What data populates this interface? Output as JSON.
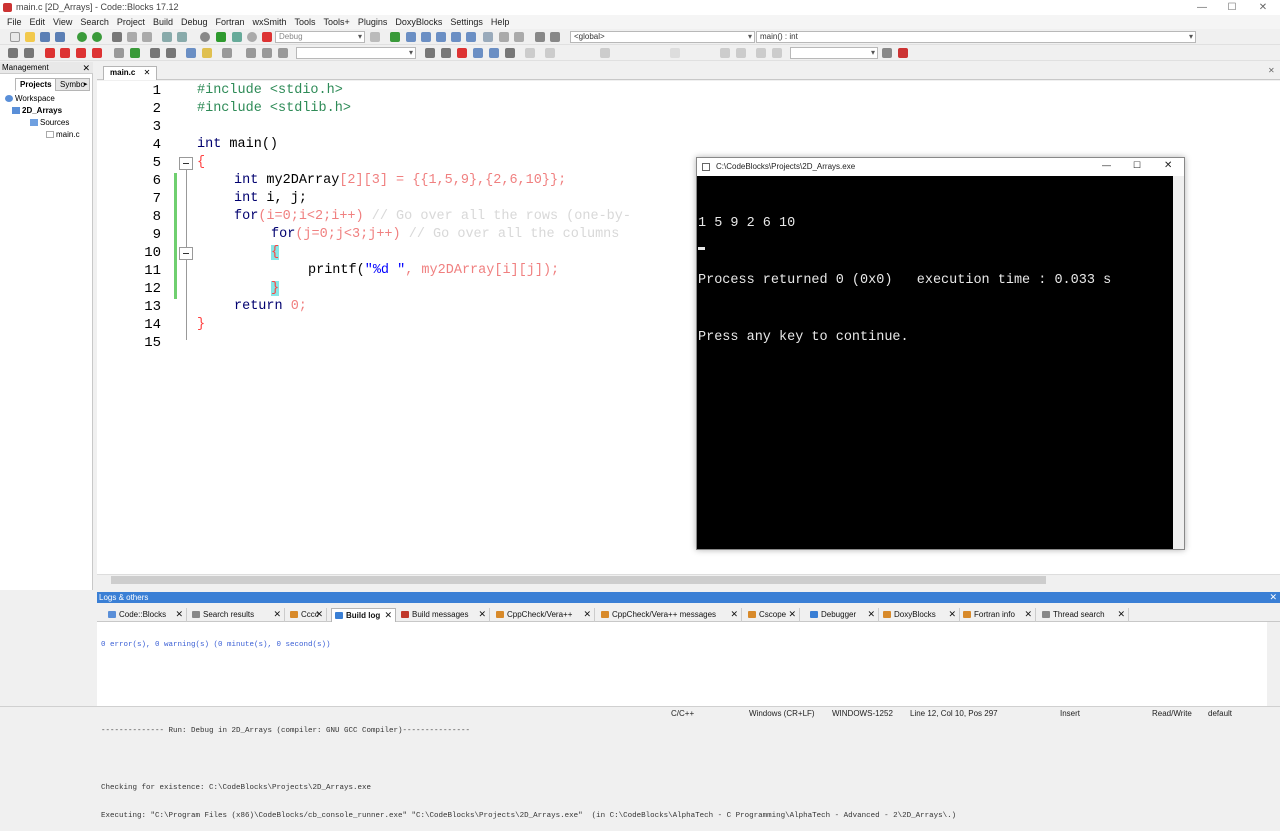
{
  "window": {
    "title": "main.c [2D_Arrays] - Code::Blocks 17.12",
    "min": "—",
    "max": "☐",
    "close": "✕"
  },
  "menu": [
    "File",
    "Edit",
    "View",
    "Search",
    "Project",
    "Build",
    "Debug",
    "Fortran",
    "wxSmith",
    "Tools",
    "Tools+",
    "Plugins",
    "DoxyBlocks",
    "Settings",
    "Help"
  ],
  "toolbar": {
    "build_target": "Debug",
    "scope": "<global>",
    "symbol": "main() : int"
  },
  "management": {
    "header": "Management",
    "close": "✕",
    "tabs": [
      "Projects",
      "Symbo"
    ],
    "tree": {
      "workspace": "Workspace",
      "project": "2D_Arrays",
      "sources": "Sources",
      "file": "main.c"
    }
  },
  "editor": {
    "tab": "main.c",
    "tab_close": "✕",
    "line_numbers": [
      "1",
      "2",
      "3",
      "4",
      "5",
      "6",
      "7",
      "8",
      "9",
      "10",
      "11",
      "12",
      "13",
      "14",
      "15"
    ],
    "lines": {
      "l1": "#include <stdio.h>",
      "l2": "#include <stdlib.h>",
      "l4_kw": "int",
      "l4_rest": " main()",
      "l5": "{",
      "l6_kw": "int",
      "l6_a": " my2DArray",
      "l6_b": "[2][3] = {{1,5,9},{2,6,10}};",
      "l7_kw": "int",
      "l7_rest": " i, j;",
      "l8_kw": "for",
      "l8_code": "(i=0;i<2;i++)",
      "l8_cmt": " // Go over all the rows (one-by-",
      "l9_kw": "for",
      "l9_code": "(j=0;j<3;j++)",
      "l9_cmt": " // Go over all the columns",
      "l10": "{",
      "l11_fn": "printf(",
      "l11_str": "\"%d \"",
      "l11_rest": ", my2DArray[i][j]);",
      "l12": "}",
      "l13_kw": "return",
      "l13_rest": " 0;",
      "l14": "}"
    }
  },
  "console": {
    "title": "C:\\CodeBlocks\\Projects\\2D_Arrays.exe",
    "output_line1": "1 5 9 2 6 10",
    "output_line2": "Process returned 0 (0x0)   execution time : 0.033 s",
    "output_line3": "Press any key to continue.",
    "min": "—",
    "max": "☐",
    "close": "✕"
  },
  "logs": {
    "header": "Logs & others",
    "close": "✕",
    "tabs": [
      {
        "label": "Code::Blocks",
        "color": "#5a8fd8"
      },
      {
        "label": "Search results",
        "color": "#888888"
      },
      {
        "label": "Cccc",
        "color": "#d88a2a"
      },
      {
        "label": "Build log",
        "color": "#3a7fd5"
      },
      {
        "label": "Build messages",
        "color": "#c0392b"
      },
      {
        "label": "CppCheck/Vera++",
        "color": "#d88a2a"
      },
      {
        "label": "CppCheck/Vera++ messages",
        "color": "#d88a2a"
      },
      {
        "label": "Cscope",
        "color": "#d88a2a"
      },
      {
        "label": "Debugger",
        "color": "#3a7fd5"
      },
      {
        "label": "DoxyBlocks",
        "color": "#d88a2a"
      },
      {
        "label": "Fortran info",
        "color": "#d88a2a"
      },
      {
        "label": "Thread search",
        "color": "#888888"
      }
    ],
    "active_tab": "Build log",
    "lines": [
      "0 error(s), 0 warning(s) (0 minute(s), 0 second(s))",
      "",
      "",
      "-------------- Run: Debug in 2D_Arrays (compiler: GNU GCC Compiler)---------------",
      "",
      "Checking for existence: C:\\CodeBlocks\\Projects\\2D_Arrays.exe",
      "Executing: \"C:\\Program Files (x86)\\CodeBlocks/cb_console_runner.exe\" \"C:\\CodeBlocks\\Projects\\2D_Arrays.exe\"  (in C:\\CodeBlocks\\AlphaTech - C Programming\\AlphaTech - Advanced - 2\\2D_Arrays\\.)"
    ]
  },
  "status": {
    "lang": "C/C++",
    "eol": "Windows (CR+LF)",
    "encoding": "WINDOWS-1252",
    "position": "Line 12, Col 10, Pos 297",
    "mode": "Insert",
    "rw": "Read/Write",
    "profile": "default"
  }
}
